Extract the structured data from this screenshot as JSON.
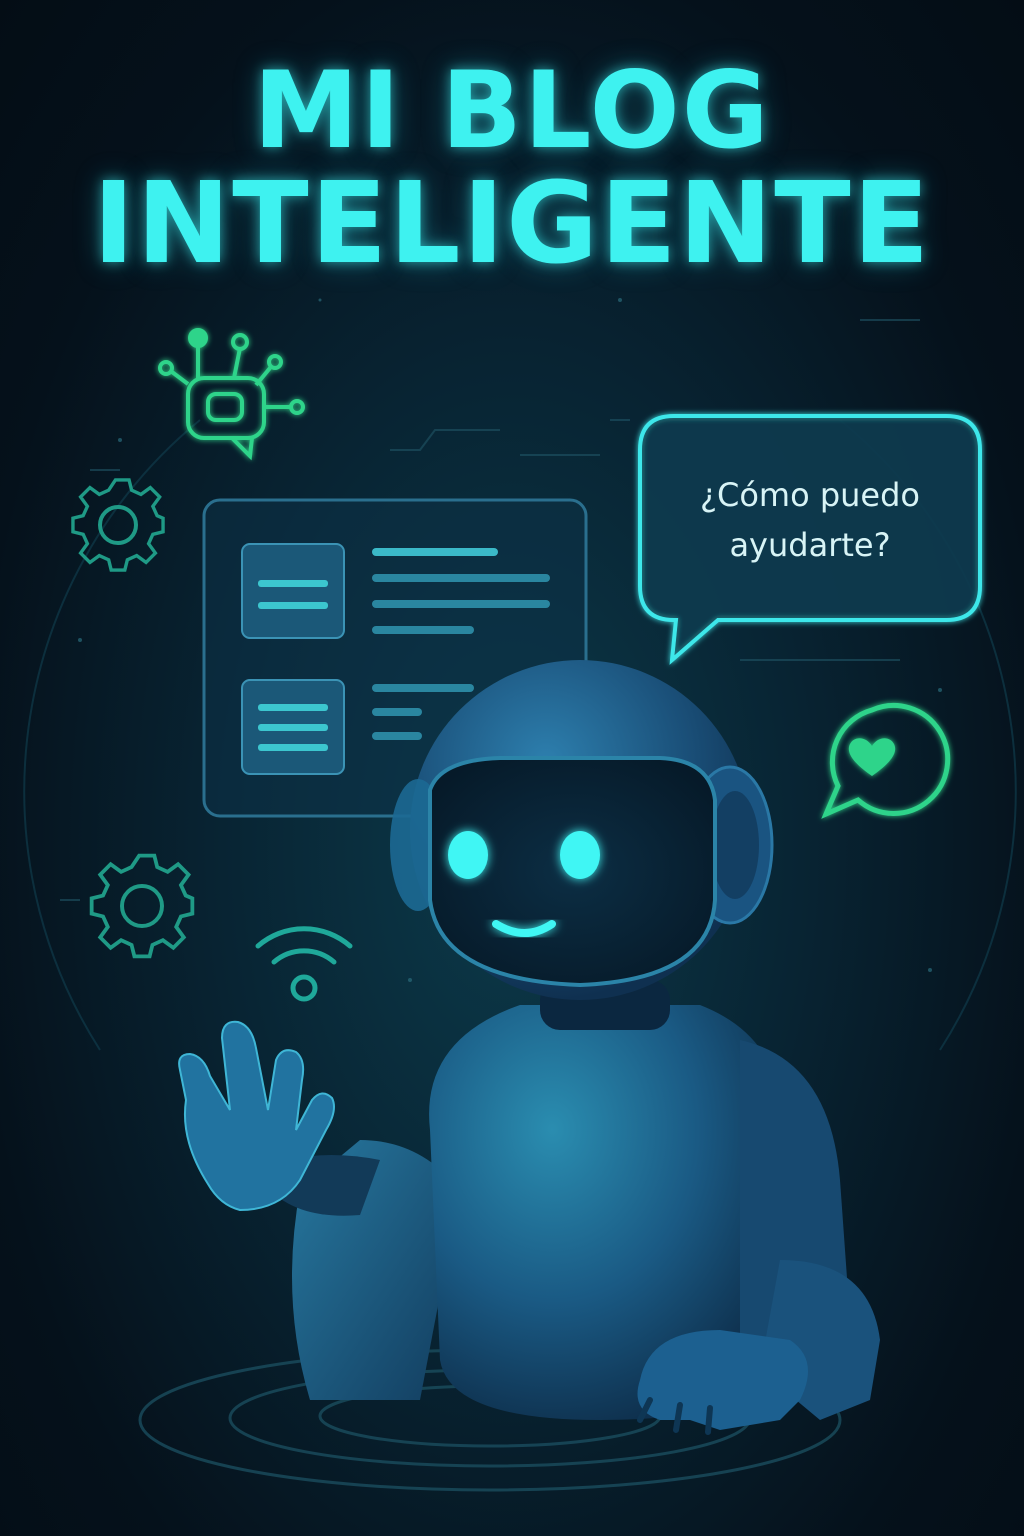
{
  "title": {
    "line1": "MI BLOG",
    "line2": "INTELIGENTE"
  },
  "speech_bubble": {
    "line1": "¿Cómo puedo",
    "line2": "ayudarte?"
  },
  "icons": [
    "robot-network-icon",
    "gear-icon",
    "gear-icon",
    "wifi-icon",
    "heart-chat-icon",
    "blog-card-icon"
  ],
  "colors": {
    "accent": "#3ef2f0",
    "green_accent": "#2fd48a",
    "background": "#06141f",
    "robot_body": "#1d5c86"
  }
}
